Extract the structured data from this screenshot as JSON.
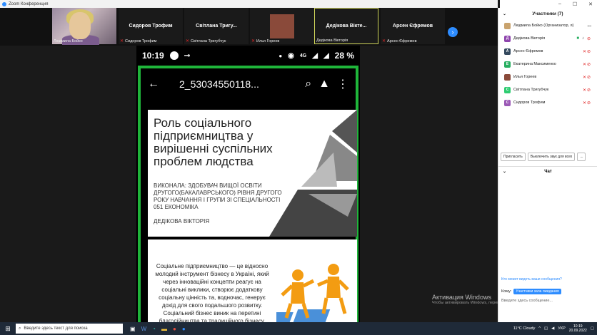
{
  "window": {
    "title": "Zoom Конференция",
    "controls": [
      "–",
      "☐",
      "✕"
    ]
  },
  "gallery": {
    "tiles": [
      {
        "name": "Людмила Бойко",
        "label": "",
        "muted": false
      },
      {
        "name": "Сидоров Трофим",
        "label": "Сидоров Трофим",
        "muted": true
      },
      {
        "name": "Світлана Тригубчук",
        "label": "Світлана Тригу...",
        "muted": true
      },
      {
        "name": "Илья Гореев",
        "label": "",
        "muted": true
      },
      {
        "name": "Дедікова Вікторія",
        "label": "Дедікова Вікте...",
        "muted": false
      },
      {
        "name": "Арсен Єфремов",
        "label": "Арсен Єфремов",
        "muted": true
      }
    ]
  },
  "phone": {
    "time": "10:19",
    "battery": "28 %",
    "network": "4G",
    "file_title": "2_53034550118...",
    "slide1": {
      "heading": "Роль соціального підприємництва у вирішенні суспільних проблем людства",
      "sub": "Виконала: здобувач вищої освіти другого(бакалаврського) рівня другого року навчання І групи зі спеціальності 051 Економіка",
      "author": "Дедікова Вікторія"
    },
    "slide2": {
      "text": "Соціальне підприємництво — це відносно молодий інструмент бізнесу в Україні, який через інноваційні концепти реагує на соціальні виклики, створює додаткову соціальну цінність та, водночас, генерує дохід для свого подальшого розвитку. Соціальний бізнес виник на перетині благодійництва та традиційного бізнесу."
    }
  },
  "watermark": {
    "title": "Активация Windows",
    "text": "Чтобы активировать Windows, перейдите в раздел \"Параметры\"."
  },
  "participants": {
    "header": "Участники (7)",
    "list": [
      {
        "initial": "",
        "name": "Людмила Бойко (Организатор, я)",
        "color": "#c9a36e"
      },
      {
        "initial": "Д",
        "name": "Дедікова Вікторія",
        "color": "#8e44ad"
      },
      {
        "initial": "А",
        "name": "Арсен Єфремов",
        "color": "#34495e"
      },
      {
        "initial": "Е",
        "name": "Екатерина Максименко",
        "color": "#27ae60"
      },
      {
        "initial": "",
        "name": "Илья Гореев",
        "color": "#8a4a3a"
      },
      {
        "initial": "С",
        "name": "Світлана Тригубчук",
        "color": "#2ecc71"
      },
      {
        "initial": "С",
        "name": "Сидоров Трофим",
        "color": "#9b59b6"
      }
    ],
    "invite_label": "Пригласить",
    "mute_all_label": "Выключить звук для всех",
    "more_label": "..."
  },
  "chat": {
    "header": "Чат",
    "who_can_see": "Кто может видеть ваши сообщения?",
    "to_label": "Кому:",
    "to_value": "Участники зала ожидания",
    "input_placeholder": "Введите здесь сообщение..."
  },
  "taskbar": {
    "search_placeholder": "Введите здесь текст для поиска",
    "weather": "11°C  Cloudy",
    "lang": "УКР",
    "time": "10:19",
    "date": "20.09.2022"
  }
}
